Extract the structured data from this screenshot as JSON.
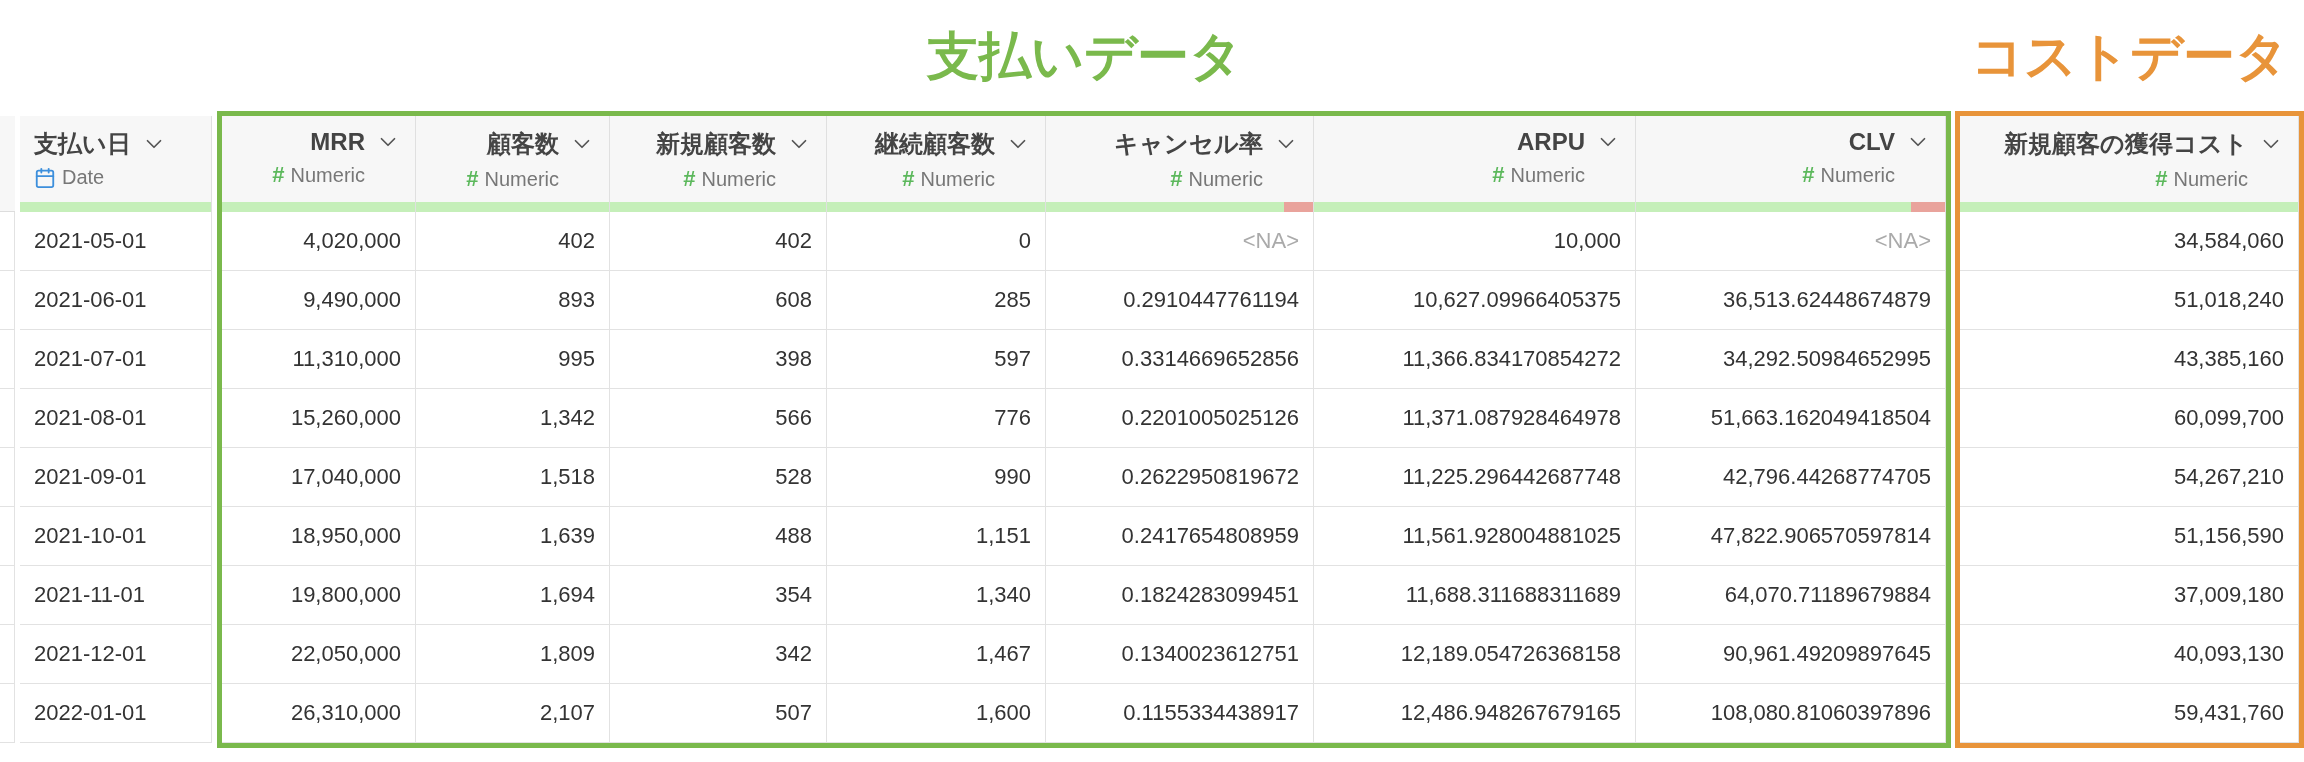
{
  "sections": [
    {
      "kind": "plain",
      "columns": [
        {
          "name": "支払い日",
          "kind": "date",
          "type_label": "Date",
          "quality": {
            "level": 1
          }
        }
      ]
    },
    {
      "kind": "framed",
      "title": "支払いデータ",
      "color": "#7ab94c",
      "columns": [
        {
          "name": "MRR",
          "kind": "numeric",
          "type_icon": "#",
          "type_label": "Numeric",
          "quality": {
            "level": 1
          }
        },
        {
          "name": "顧客数",
          "kind": "numeric",
          "type_icon": "#",
          "type_label": "Numeric",
          "quality": {
            "level": 1
          }
        },
        {
          "name": "新規顧客数",
          "kind": "numeric",
          "type_icon": "#",
          "type_label": "Numeric",
          "quality": {
            "level": 1
          }
        },
        {
          "name": "継続顧客数",
          "kind": "numeric",
          "type_icon": "#",
          "type_label": "Numeric",
          "quality": {
            "level": 1
          }
        },
        {
          "name": "キャンセル率",
          "kind": "numeric",
          "type_icon": "#",
          "type_label": "Numeric",
          "quality": {
            "level": 0.89
          }
        },
        {
          "name": "ARPU",
          "kind": "numeric",
          "type_icon": "#",
          "type_label": "Numeric",
          "quality": {
            "level": 1
          }
        },
        {
          "name": "CLV",
          "kind": "numeric",
          "type_icon": "#",
          "type_label": "Numeric",
          "quality": {
            "level": 0.89
          }
        }
      ]
    },
    {
      "kind": "framed",
      "title": "コストデータ",
      "color": "#e8943a",
      "columns": [
        {
          "name": "新規顧客の獲得コスト",
          "kind": "numeric",
          "type_icon": "#",
          "type_label": "Numeric",
          "quality": {
            "level": 1
          }
        }
      ]
    }
  ],
  "rows": [
    [
      "2021-05-01",
      "4,020,000",
      "402",
      "402",
      "0",
      {
        "text": "<NA>",
        "missing": true
      },
      "10,000",
      {
        "text": "<NA>",
        "missing": true
      },
      "34,584,060"
    ],
    [
      "2021-06-01",
      "9,490,000",
      "893",
      "608",
      "285",
      "0.2910447761194",
      "10,627.09966405375",
      "36,513.62448674879",
      "51,018,240"
    ],
    [
      "2021-07-01",
      "11,310,000",
      "995",
      "398",
      "597",
      "0.3314669652856",
      "11,366.834170854272",
      "34,292.50984652995",
      "43,385,160"
    ],
    [
      "2021-08-01",
      "15,260,000",
      "1,342",
      "566",
      "776",
      "0.2201005025126",
      "11,371.087928464978",
      "51,663.162049418504",
      "60,099,700"
    ],
    [
      "2021-09-01",
      "17,040,000",
      "1,518",
      "528",
      "990",
      "0.2622950819672",
      "11,225.296442687748",
      "42,796.44268774705",
      "54,267,210"
    ],
    [
      "2021-10-01",
      "18,950,000",
      "1,639",
      "488",
      "1,151",
      "0.2417654808959",
      "11,561.928004881025",
      "47,822.906570597814",
      "51,156,590"
    ],
    [
      "2021-11-01",
      "19,800,000",
      "1,694",
      "354",
      "1,340",
      "0.1824283099451",
      "11,688.311688311689",
      "64,070.71189679884",
      "37,009,180"
    ],
    [
      "2021-12-01",
      "22,050,000",
      "1,809",
      "342",
      "1,467",
      "0.1340023612751",
      "12,189.054726368158",
      "90,961.49209897645",
      "40,093,130"
    ],
    [
      "2022-01-01",
      "26,310,000",
      "2,107",
      "507",
      "1,600",
      "0.1155334438917",
      "12,486.948267679165",
      "108,080.81060397896",
      "59,431,760"
    ]
  ]
}
